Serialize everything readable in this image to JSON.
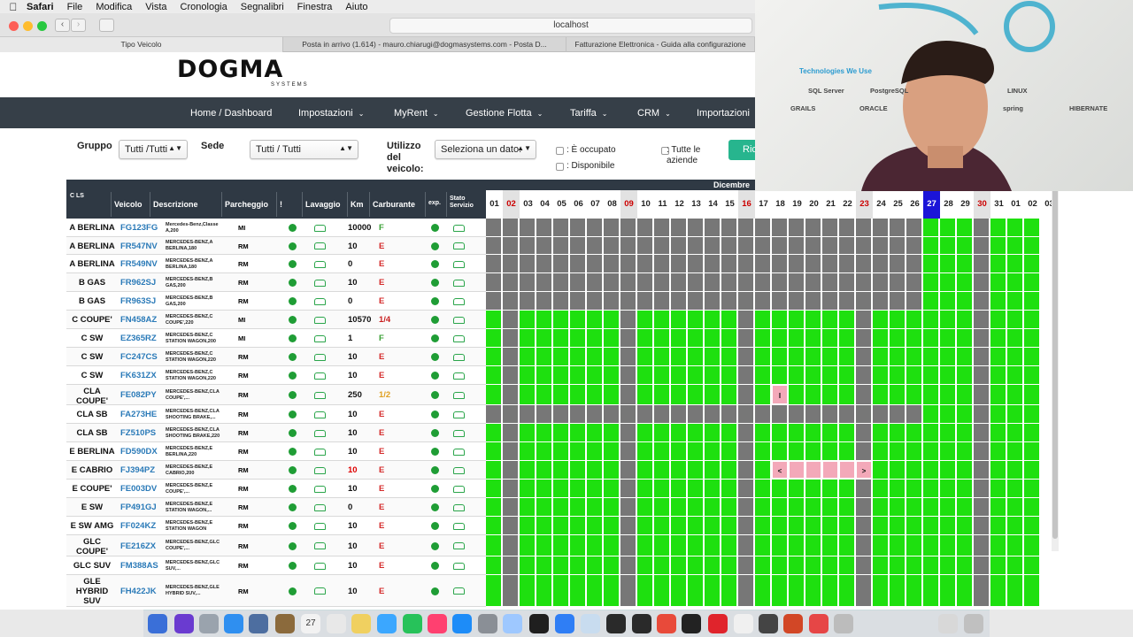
{
  "menubar": {
    "apple": "",
    "items": [
      "Safari",
      "File",
      "Modifica",
      "Vista",
      "Cronologia",
      "Segnalibri",
      "Finestra",
      "Aiuto"
    ]
  },
  "browser": {
    "url": "localhost",
    "tabs": [
      "Tipo Veicolo",
      "Posta in arrivo (1.614) - mauro.chiarugi@dogmasystems.com - Posta D...",
      "Fatturazione Elettronica - Guida alla configurazione"
    ]
  },
  "logo": {
    "name": "DOGMA",
    "sub": "SYSTEMS"
  },
  "nav": [
    "Home / Dashboard",
    "Impostazioni",
    "MyRent",
    "Gestione Flotta",
    "Tariffa",
    "CRM",
    "Importazioni"
  ],
  "filters": {
    "gruppo_label": "Gruppo",
    "gruppo_value": "Tutti /Tutti",
    "sede_label": "Sede",
    "sede_value": "Tutti / Tutti",
    "utilizzo_label": "Utilizzo del veicolo:",
    "utilizzo_value": "Seleziona un dato.",
    "occupato": ": È occupato",
    "disponibile": ": Disponibile",
    "tutte": ": Tutte le aziende",
    "button": "Ric"
  },
  "table": {
    "headers": [
      "C LS",
      "Veicolo",
      "Descrizione",
      "Parcheggio",
      "!",
      "Lavaggio",
      "Km",
      "Carburante",
      "exp.",
      "Stato Servizio"
    ],
    "month": "Dicembre",
    "days": [
      "01",
      "02",
      "03",
      "04",
      "05",
      "06",
      "07",
      "08",
      "09",
      "10",
      "11",
      "12",
      "13",
      "14",
      "15",
      "16",
      "17",
      "18",
      "19",
      "20",
      "21",
      "22",
      "23",
      "24",
      "25",
      "26",
      "27",
      "28",
      "29",
      "30",
      "31",
      "01",
      "02",
      "03"
    ],
    "rows": [
      {
        "cat": "A BERLINA",
        "plate": "FG123FG",
        "desc": "Mercedes-Benz,Classe A,200",
        "park": "MI",
        "km": "10000",
        "fuel": "F"
      },
      {
        "cat": "A BERLINA",
        "plate": "FR547NV",
        "desc": "MERCEDES-BENZ,A BERLINA,180",
        "park": "RM",
        "km": "10",
        "fuel": "E"
      },
      {
        "cat": "A BERLINA",
        "plate": "FR549NV",
        "desc": "MERCEDES-BENZ,A BERLINA,180",
        "park": "RM",
        "km": "0",
        "fuel": "E"
      },
      {
        "cat": "B GAS",
        "plate": "FR962SJ",
        "desc": "MERCEDES-BENZ,B GAS,200",
        "park": "RM",
        "km": "10",
        "fuel": "E"
      },
      {
        "cat": "B GAS",
        "plate": "FR963SJ",
        "desc": "MERCEDES-BENZ,B GAS,200",
        "park": "RM",
        "km": "0",
        "fuel": "E"
      },
      {
        "cat": "C COUPE'",
        "plate": "FN458AZ",
        "desc": "MERCEDES-BENZ,C COUPE',220",
        "park": "MI",
        "km": "10570",
        "fuel": "1/4"
      },
      {
        "cat": "C SW",
        "plate": "EZ365RZ",
        "desc": "MERCEDES-BENZ,C STATION WAGON,200",
        "park": "MI",
        "km": "1",
        "fuel": "F"
      },
      {
        "cat": "C SW",
        "plate": "FC247CS",
        "desc": "MERCEDES-BENZ,C STATION WAGON,220",
        "park": "RM",
        "km": "10",
        "fuel": "E"
      },
      {
        "cat": "C SW",
        "plate": "FK631ZX",
        "desc": "MERCEDES-BENZ,C STATION WAGON,220",
        "park": "RM",
        "km": "10",
        "fuel": "E"
      },
      {
        "cat": "CLA COUPE'",
        "plate": "FE082PY",
        "desc": "MERCEDES-BENZ,CLA COUPE',...",
        "park": "RM",
        "km": "250",
        "fuel": "1/2"
      },
      {
        "cat": "CLA SB",
        "plate": "FA273HE",
        "desc": "MERCEDES-BENZ,CLA SHOOTING BRAKE,...",
        "park": "RM",
        "km": "10",
        "fuel": "E"
      },
      {
        "cat": "CLA SB",
        "plate": "FZ510PS",
        "desc": "MERCEDES-BENZ,CLA SHOOTING BRAKE,220",
        "park": "RM",
        "km": "10",
        "fuel": "E"
      },
      {
        "cat": "E BERLINA",
        "plate": "FD590DX",
        "desc": "MERCEDES-BENZ,E BERLINA,220",
        "park": "RM",
        "km": "10",
        "fuel": "E"
      },
      {
        "cat": "E CABRIO",
        "plate": "FJ394PZ",
        "desc": "MERCEDES-BENZ,E CABRIO,200",
        "park": "RM",
        "km": "10",
        "fuel": "E"
      },
      {
        "cat": "E COUPE'",
        "plate": "FE003DV",
        "desc": "MERCEDES-BENZ,E COUPE',...",
        "park": "RM",
        "km": "10",
        "fuel": "E"
      },
      {
        "cat": "E SW",
        "plate": "FP491GJ",
        "desc": "MERCEDES-BENZ,E STATION WAGON,...",
        "park": "RM",
        "km": "0",
        "fuel": "E"
      },
      {
        "cat": "E SW AMG",
        "plate": "FF024KZ",
        "desc": "MERCEDES-BENZ,E STATION WAGON",
        "park": "RM",
        "km": "10",
        "fuel": "E"
      },
      {
        "cat": "GLC COUPE'",
        "plate": "FE216ZX",
        "desc": "MERCEDES-BENZ,GLC COUPE',...",
        "park": "RM",
        "km": "10",
        "fuel": "E"
      },
      {
        "cat": "GLC SUV",
        "plate": "FM388AS",
        "desc": "MERCEDES-BENZ,GLC SUV,...",
        "park": "RM",
        "km": "10",
        "fuel": "E"
      },
      {
        "cat": "GLE HYBRID SUV",
        "plate": "FH422JK",
        "desc": "MERCEDES-BENZ,GLE HYBRID SUV,...",
        "park": "RM",
        "km": "10",
        "fuel": "E"
      }
    ],
    "markers": {
      "booking_start": "I",
      "arrow_left": "<",
      "arrow_right": ">"
    }
  },
  "webcam": {
    "techs": "Technologies We Use",
    "logos": [
      "SQL Server",
      "PostgreSQL",
      "LINUX",
      "GRAILS",
      "ORACLE",
      "spring",
      "HIBERNATE"
    ]
  },
  "dock": {
    "calendar_day": "27"
  },
  "colors": {
    "free": "#1ee00f",
    "unavailable": "#777777",
    "booked": "#f3a9b9",
    "today": "#1b14d8",
    "nav": "#363f48",
    "plate": "#2a7ab8"
  }
}
